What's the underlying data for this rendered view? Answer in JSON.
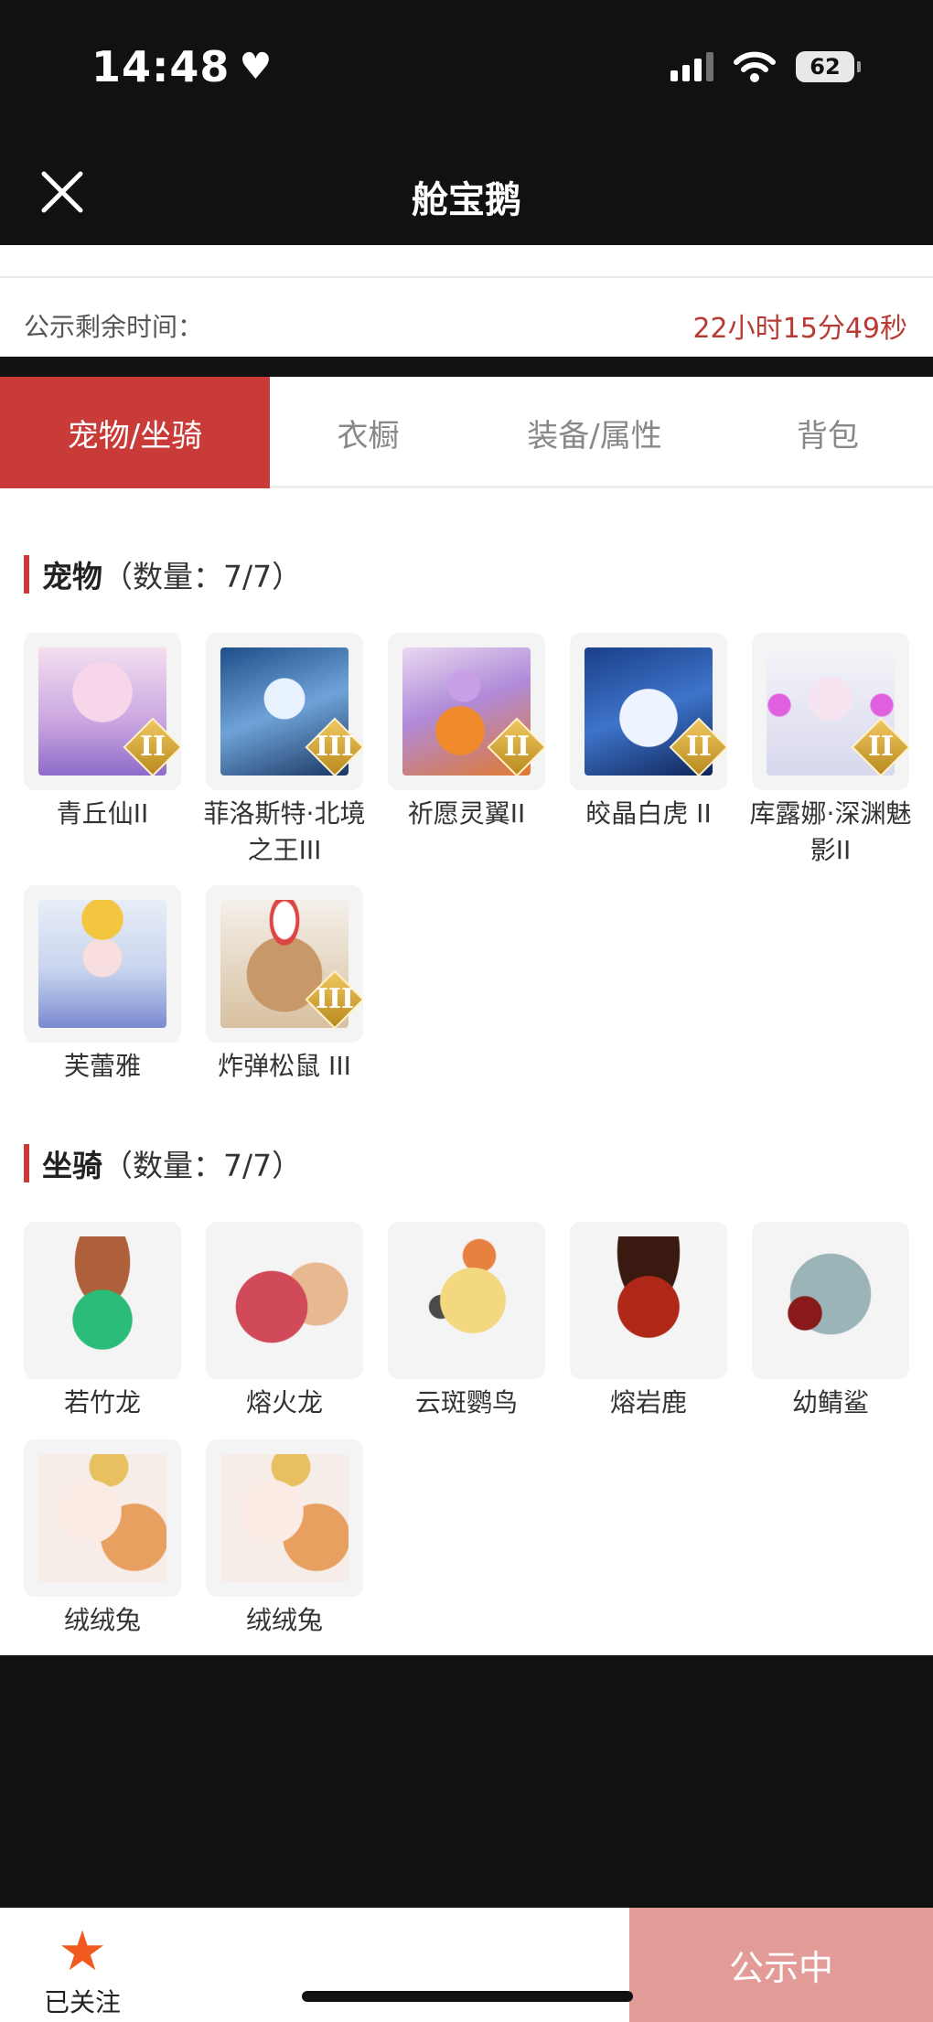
{
  "status_bar": {
    "time": "14:48",
    "battery": "62"
  },
  "header": {
    "title": "舱宝鹅"
  },
  "countdown": {
    "label": "公示剩余时间：",
    "value": "22小时15分49秒"
  },
  "tabs": [
    {
      "label": "宠物/坐骑",
      "active": true
    },
    {
      "label": "衣橱",
      "active": false
    },
    {
      "label": "装备/属性",
      "active": false
    },
    {
      "label": "背包",
      "active": false
    }
  ],
  "pets": {
    "title": "宠物",
    "count": "（数量：7/7）",
    "items": [
      {
        "name": "青丘仙II",
        "badge": "II",
        "icon": "fox-fairy-portrait"
      },
      {
        "name": "菲洛斯特·北境之王III",
        "badge": "III",
        "icon": "ice-king-portrait"
      },
      {
        "name": "祈愿灵翼II",
        "badge": "II",
        "icon": "phoenix-bird-portrait"
      },
      {
        "name": "皎晶白虎 II",
        "badge": "II",
        "icon": "white-tiger-portrait"
      },
      {
        "name": "库露娜·深渊魅影II",
        "badge": "II",
        "icon": "abyss-girl-portrait"
      },
      {
        "name": "芙蕾雅",
        "badge": "",
        "icon": "golden-valkyrie-portrait"
      },
      {
        "name": "炸弹松鼠 III",
        "badge": "III",
        "icon": "bomb-squirrel-portrait"
      }
    ]
  },
  "mounts": {
    "title": "坐骑",
    "count": "（数量：7/7）",
    "items": [
      {
        "name": "若竹龙",
        "icon": "bamboo-dragon-portrait"
      },
      {
        "name": "熔火龙",
        "icon": "fire-dragon-portrait"
      },
      {
        "name": "云斑鹦鸟",
        "icon": "cockatoo-portrait"
      },
      {
        "name": "熔岩鹿",
        "icon": "lava-deer-portrait"
      },
      {
        "name": "幼鲭鲨",
        "icon": "shark-portrait"
      },
      {
        "name": "绒绒兔",
        "icon": "fluffy-rabbit-portrait"
      },
      {
        "name": "绒绒兔",
        "icon": "fluffy-rabbit-portrait"
      }
    ]
  },
  "bottom": {
    "follow_label": "已关注",
    "status_button": "公示中"
  },
  "colors": {
    "accent": "#c93b38",
    "countdown": "#b83a35",
    "status_button": "#e39b98",
    "follow_star": "#f05a1e"
  }
}
